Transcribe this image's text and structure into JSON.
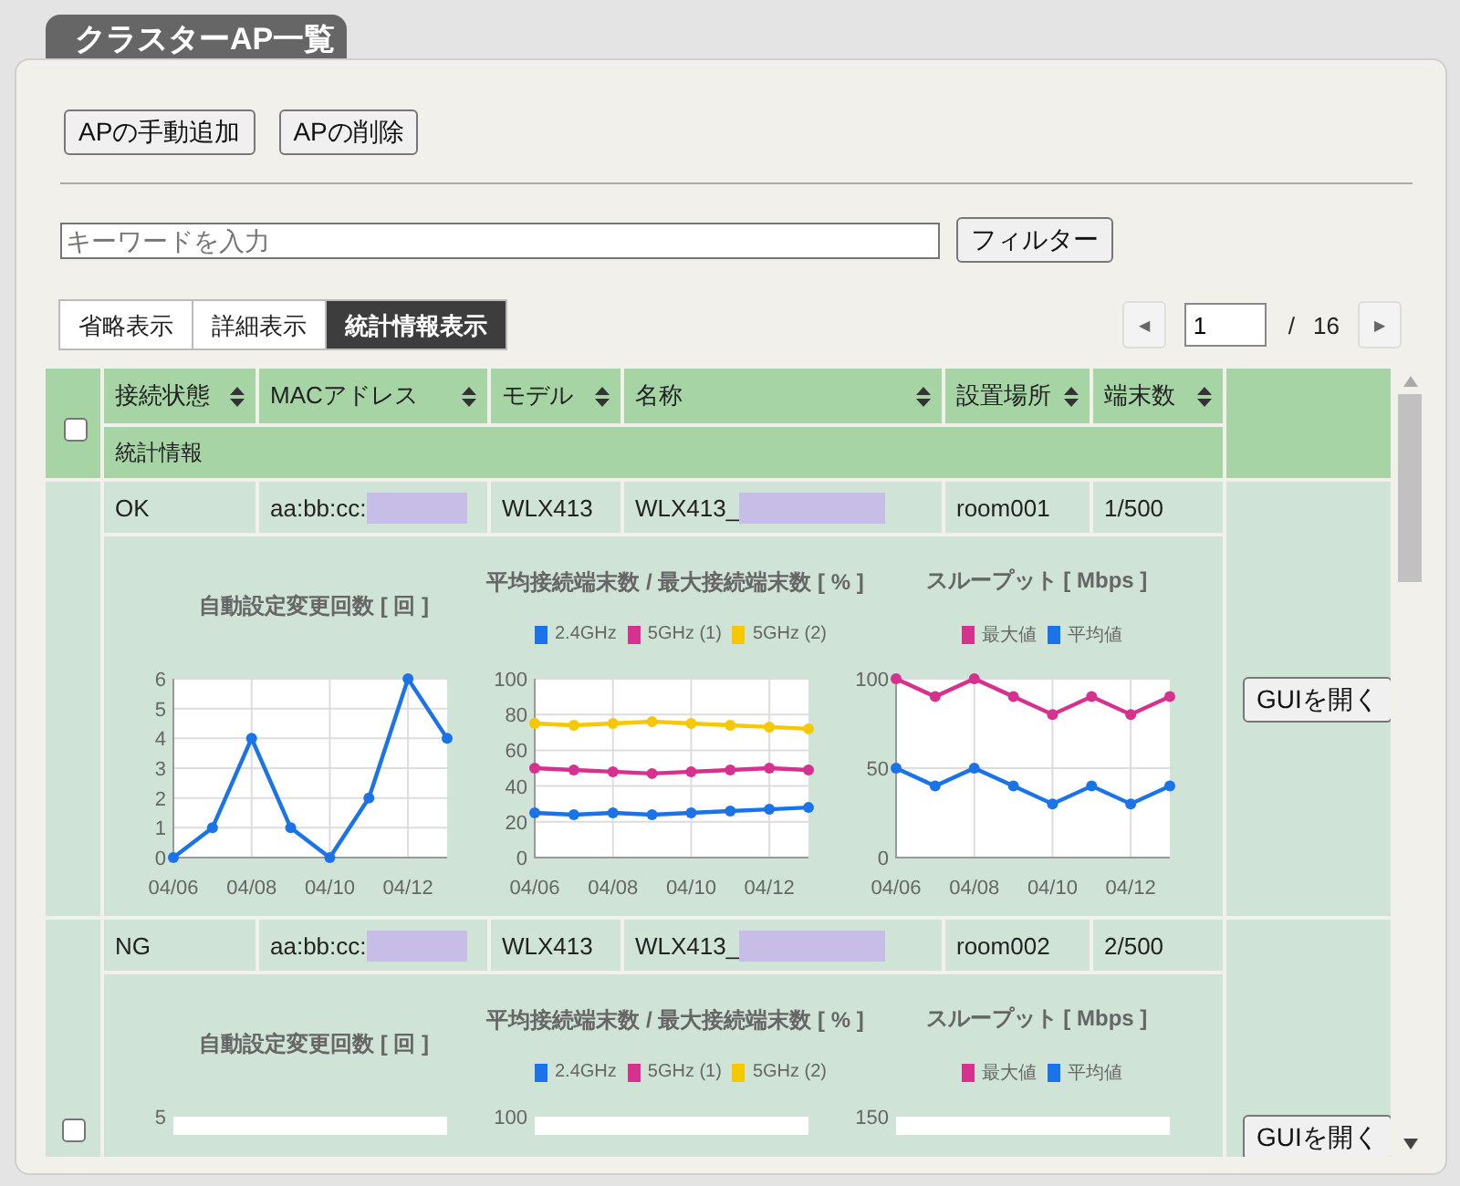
{
  "title": "クラスターAP一覧",
  "actions": [
    "APの手動追加",
    "APの削除"
  ],
  "search": {
    "placeholder": "キーワードを入力",
    "button": "フィルター"
  },
  "view_tabs": [
    {
      "label": "省略表示",
      "selected": false
    },
    {
      "label": "詳細表示",
      "selected": false
    },
    {
      "label": "統計情報表示",
      "selected": true
    }
  ],
  "pagination": {
    "prev": "◀",
    "page": "1",
    "separator": "/",
    "total": "16",
    "next": "▶"
  },
  "table": {
    "columns": [
      "接続状態",
      "MACアドレス",
      "モデル",
      "名称",
      "設置場所",
      "端末数"
    ],
    "header_checked": false,
    "stats_label": "統計情報",
    "rows": [
      {
        "status": "OK",
        "mac": "aa:bb:cc:",
        "mac_redacted": true,
        "model": "WLX413",
        "name": "WLX413_",
        "name_redacted": true,
        "location": "room001",
        "clients": "1/500",
        "button": "GUIを開く",
        "charts": [
          {
            "chart_data": {
              "type": "line",
              "title": "自動設定変更回数 [ 回 ]",
              "categories": [
                "04/06",
                null,
                "04/08",
                null,
                "04/10",
                null,
                "04/12",
                null
              ],
              "grid": true,
              "ylim": [
                0,
                6
              ],
              "yticks": [
                0,
                1,
                2,
                3,
                4,
                5,
                6
              ],
              "series": [
                {
                  "color": "#1a73e8",
                  "marker": "circle",
                  "values": [
                    0,
                    1,
                    4,
                    1,
                    0,
                    2,
                    6,
                    4
                  ]
                }
              ]
            }
          },
          {
            "chart_data": {
              "type": "line",
              "title": "平均接続端末数 / 最大接続端末数 [ % ]",
              "categories": [
                "04/06",
                null,
                "04/08",
                null,
                "04/10",
                null,
                "04/12",
                null
              ],
              "grid": true,
              "ylim": [
                0,
                100
              ],
              "yticks": [
                0,
                20,
                40,
                60,
                80,
                100
              ],
              "series": [
                {
                  "name": "2.4GHz",
                  "color": "#1a73e8",
                  "marker": "circle",
                  "values": [
                    25,
                    24,
                    25,
                    24,
                    25,
                    26,
                    27,
                    28
                  ]
                },
                {
                  "name": "5GHz (1)",
                  "color": "#d6318f",
                  "marker": "circle",
                  "values": [
                    50,
                    49,
                    48,
                    47,
                    48,
                    49,
                    50,
                    49
                  ]
                },
                {
                  "name": "5GHz (2)",
                  "color": "#f5c800",
                  "marker": "circle",
                  "values": [
                    75,
                    74,
                    75,
                    76,
                    75,
                    74,
                    73,
                    72
                  ]
                }
              ]
            }
          },
          {
            "chart_data": {
              "type": "line",
              "title": "スループット [ Mbps ]",
              "categories": [
                "04/06",
                null,
                "04/08",
                null,
                "04/10",
                null,
                "04/12",
                null
              ],
              "grid": true,
              "ylim": [
                0,
                100
              ],
              "yticks": [
                0,
                50,
                100
              ],
              "series": [
                {
                  "name": "最大値",
                  "color": "#d6318f",
                  "marker": "circle",
                  "values": [
                    100,
                    90,
                    100,
                    90,
                    80,
                    90,
                    80,
                    90
                  ]
                },
                {
                  "name": "平均値",
                  "color": "#1a73e8",
                  "marker": "circle",
                  "values": [
                    50,
                    40,
                    50,
                    40,
                    30,
                    40,
                    30,
                    40
                  ]
                }
              ]
            }
          }
        ]
      },
      {
        "status": "NG",
        "mac": "aa:bb:cc:",
        "mac_redacted": true,
        "model": "WLX413",
        "name": "WLX413_",
        "name_redacted": true,
        "location": "room002",
        "clients": "2/500",
        "checked": false,
        "button": "GUIを開く",
        "charts": [
          {
            "title": "自動設定変更回数 [ 回 ]",
            "top_tick": "5"
          },
          {
            "title": "平均接続端末数 / 最大接続端末数 [ % ]",
            "series": [
              {
                "name": "2.4GHz",
                "color": "#1a73e8"
              },
              {
                "name": "5GHz (1)",
                "color": "#d6318f"
              },
              {
                "name": "5GHz (2)",
                "color": "#f5c800"
              }
            ],
            "top_tick": "100"
          },
          {
            "title": "スループット [ Mbps ]",
            "series": [
              {
                "name": "最大値",
                "color": "#d6318f"
              },
              {
                "name": "平均値",
                "color": "#1a73e8"
              }
            ],
            "top_tick": "150"
          }
        ]
      }
    ]
  }
}
